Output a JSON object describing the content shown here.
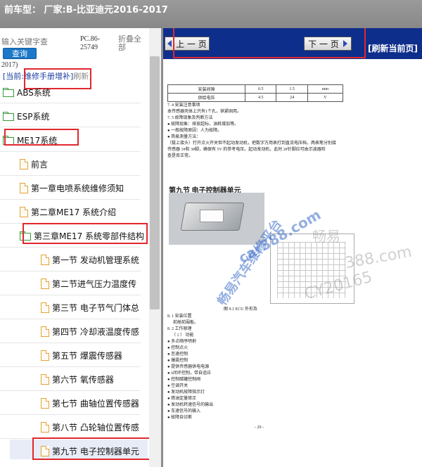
{
  "header": {
    "title": "前车型：   厂家:B-比亚迪元2016-2017"
  },
  "search": {
    "placeholder": "输入关键字查",
    "button_label": "查询"
  },
  "model": {
    "code": "PC.86-25749",
    "collapse_all": "折叠全部",
    "year_fragment": "2017)"
  },
  "current": {
    "prefix": "[当前:",
    "book": "维修手册增补",
    "suffix": "]",
    "refresh": "刷新]"
  },
  "tree": {
    "items": [
      {
        "label": "ABS系统",
        "type": "folder"
      },
      {
        "label": "ESP系统",
        "type": "folder"
      },
      {
        "label": "ME17系统",
        "type": "folder-open"
      },
      {
        "label": "前言",
        "type": "page"
      },
      {
        "label": "第一章电喷系统维修须知",
        "type": "page"
      },
      {
        "label": "第二章ME17 系统介绍",
        "type": "page"
      },
      {
        "label": "第三章ME17 系统零部件结构",
        "type": "folder-open"
      },
      {
        "label": "第一节 发动机管理系统",
        "type": "page"
      },
      {
        "label": "第二节进气压力温度传",
        "type": "page"
      },
      {
        "label": "第三节 电子节气门体总",
        "type": "page"
      },
      {
        "label": "第四节 冷却液温度传感",
        "type": "page"
      },
      {
        "label": "第五节 爆震传感器",
        "type": "page"
      },
      {
        "label": "第六节 氧传感器",
        "type": "page"
      },
      {
        "label": "第七节 曲轴位置传感器",
        "type": "page"
      },
      {
        "label": "第八节 凸轮轴位置传感",
        "type": "page"
      },
      {
        "label": "第九节 电子控制器单元",
        "type": "page"
      }
    ]
  },
  "nav": {
    "prev": "上 一 页",
    "next": "下 一 页",
    "refresh_page": "[刷新当前页]"
  },
  "doc": {
    "table": [
      [
        "安装间隙",
        "0.5",
        "1.5",
        "mm"
      ],
      [
        "供给电压",
        "4.5",
        "24",
        "V"
      ]
    ],
    "lines": [
      "7. 4 安装注意事项",
      "本传感器壳体上只有1个孔，供紧固用。",
      "7. 5 故障现象及判断方法",
      "●  故障现象：排放超标，油耗增加等。",
      "●  一般故障原因：人为故障。",
      "●  简易测量方法：",
      "（拔上接头）打开点火开关但不起动发动机，把数字万用表打到直流电压档，两表笔分别接",
      "传感器 1#和 3#脚，确保有 5V 的参考电压。起动发动机，此时 2#针脚应可由示波器检",
      "查是否正常。"
    ],
    "section_title": "第九节  电子控制器单元",
    "figure_caption": "图 9.1 ECU 外形及",
    "sub_lines": [
      "8. 1 安装位置",
      "前舱前围板。",
      "8. 2 工作原理",
      "（ 1 ）  功能",
      "●  多点顺序喷射",
      "●  控制点火",
      "●  怠速控制",
      "●  爆震控制",
      "●  提供传感器供电电源",
      "●  λ闭环控制，带自适应",
      "●  控制碳罐控制阀",
      "●  空调开关",
      "●  发动机故障指示灯",
      "●  燃油定量修正",
      "●  发动机转速信号的输出",
      "●  车速信号的输入",
      "●  故障自诊断"
    ],
    "page_number": "- 29 -",
    "watermarks": [
      "car388.com",
      "畅易汽车维修平台",
      "畅易",
      "388.com",
      "CY20165"
    ]
  }
}
